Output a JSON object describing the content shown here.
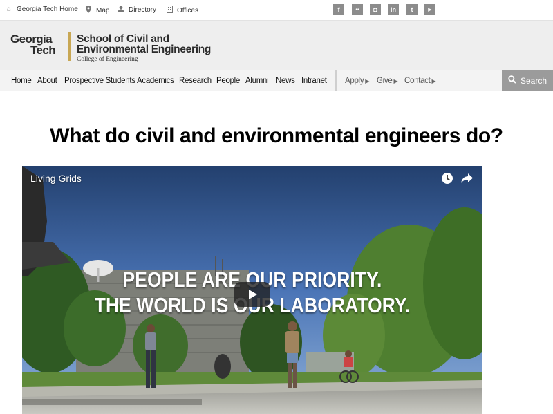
{
  "utility_bar": {
    "links": [
      {
        "label": "Georgia Tech Home",
        "icon": "home-icon"
      },
      {
        "label": "Map",
        "icon": "map-pin-icon"
      },
      {
        "label": "Directory",
        "icon": "person-icon"
      },
      {
        "label": "Offices",
        "icon": "building-icon"
      }
    ],
    "social": [
      {
        "icon": "facebook-icon",
        "glyph": "f"
      },
      {
        "icon": "flickr-icon",
        "glyph": "••"
      },
      {
        "icon": "instagram-icon",
        "glyph": "◘"
      },
      {
        "icon": "linkedin-icon",
        "glyph": "in"
      },
      {
        "icon": "twitter-icon",
        "glyph": "t"
      },
      {
        "icon": "youtube-icon",
        "glyph": "▶"
      }
    ]
  },
  "header": {
    "logo_line1": "Georgia",
    "logo_line2": "Tech",
    "school_line1": "School of Civil and",
    "school_line2": "Environmental Engineering",
    "college": "College of Engineering",
    "accent_color": "#c8a754"
  },
  "nav": {
    "primary": [
      "Home",
      "About",
      "Prospective Students",
      "Academics",
      "Research",
      "People",
      "Alumni",
      "News",
      "Intranet"
    ],
    "secondary": [
      "Apply",
      "Give",
      "Contact"
    ],
    "search_label": "Search"
  },
  "main": {
    "title": "What do civil and environmental engineers do?"
  },
  "video": {
    "title": "Living Grids",
    "caption_line1": "PEOPLE ARE OUR PRIORITY.",
    "caption_line2": "THE WORLD IS OUR LABORATORY."
  }
}
